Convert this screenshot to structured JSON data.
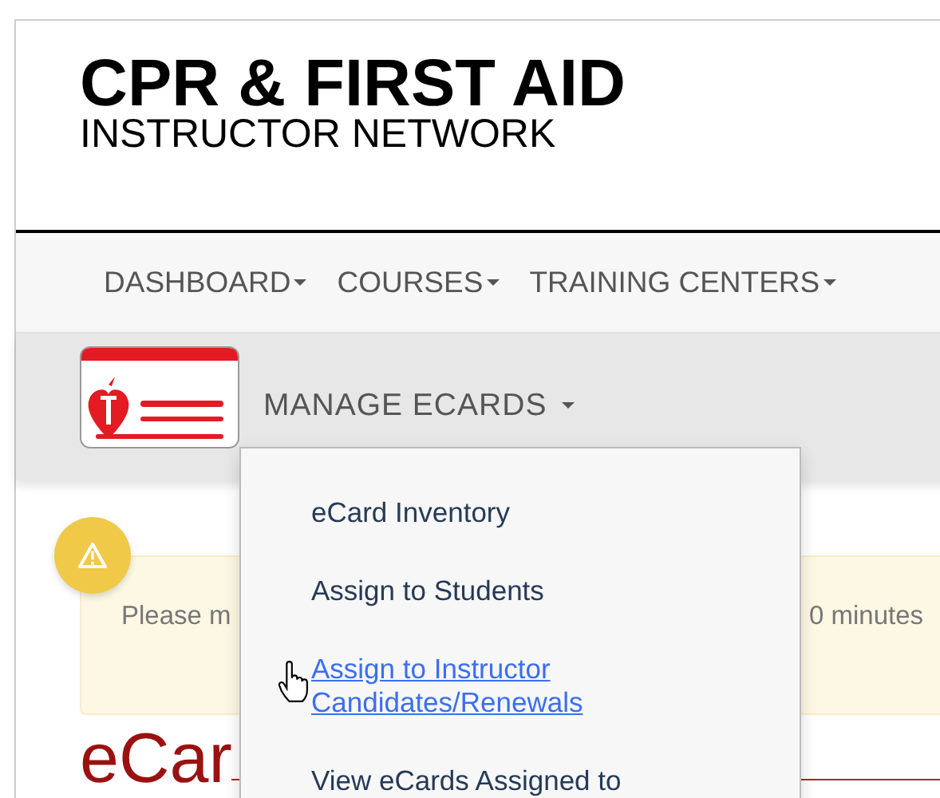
{
  "header": {
    "title": "CPR & FIRST AID",
    "subtitle": "INSTRUCTOR NETWORK"
  },
  "nav": {
    "items": [
      {
        "label": "DASHBOARD"
      },
      {
        "label": "COURSES"
      },
      {
        "label": "TRAINING CENTERS"
      }
    ]
  },
  "subnav": {
    "menu": {
      "label": "MANAGE ECARDS",
      "expanded": true,
      "items": [
        {
          "label": "eCard Inventory",
          "hovered": false
        },
        {
          "label": "Assign to Students",
          "hovered": false
        },
        {
          "label": "Assign to Instructor Candidates/Renewals",
          "hovered": true
        },
        {
          "label": "View eCards Assigned to",
          "hovered": false
        }
      ]
    }
  },
  "alert": {
    "text_left": "Please m",
    "text_right": "0 minutes"
  },
  "heading": "eCar"
}
